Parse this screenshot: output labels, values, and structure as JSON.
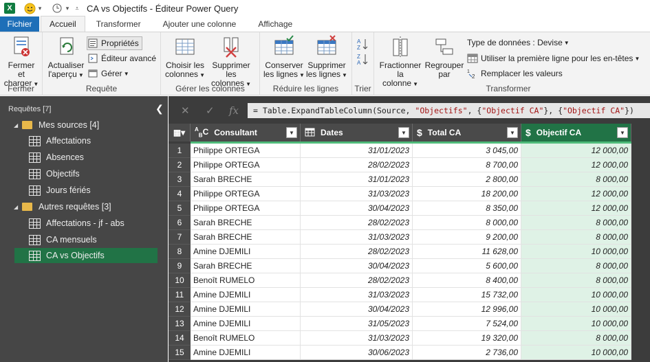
{
  "window": {
    "title": "CA vs Objectifs - Éditeur Power Query"
  },
  "tabs": [
    {
      "label": "Fichier"
    },
    {
      "label": "Accueil"
    },
    {
      "label": "Transformer"
    },
    {
      "label": "Ajouter une colonne"
    },
    {
      "label": "Affichage"
    }
  ],
  "ribbon": {
    "fermer": {
      "btn_line1": "Fermer et",
      "btn_line2": "charger",
      "group": "Fermer"
    },
    "requete": {
      "actualiser_line1": "Actualiser",
      "actualiser_line2": "l'aperçu",
      "proprietes": "Propriétés",
      "editeur": "Éditeur avancé",
      "gerer": "Gérer",
      "group": "Requête"
    },
    "colonnes": {
      "choisir_line1": "Choisir les",
      "choisir_line2": "colonnes",
      "supprimer_line1": "Supprimer les",
      "supprimer_line2": "colonnes",
      "group": "Gérer les colonnes"
    },
    "lignes": {
      "conserver_line1": "Conserver",
      "conserver_line2": "les lignes",
      "supprimer_line1": "Supprimer",
      "supprimer_line2": "les lignes",
      "group": "Réduire les lignes"
    },
    "trier": {
      "group": "Trier"
    },
    "transformer": {
      "fractionner_line1": "Fractionner",
      "fractionner_line2": "la colonne",
      "regrouper_line1": "Regrouper",
      "regrouper_line2": "par",
      "type_donnees": "Type de données : Devise",
      "premiere_ligne": "Utiliser la première ligne pour les en-têtes",
      "remplacer": "Remplacer les valeurs",
      "group": "Transformer"
    }
  },
  "queries_pane": {
    "header": "Requêtes [7]",
    "groups": [
      {
        "name": "Mes sources [4]",
        "items": [
          "Affectations",
          "Absences",
          "Objectifs",
          "Jours fériés"
        ]
      },
      {
        "name": "Autres requêtes [3]",
        "items": [
          "Affectations - jf - abs",
          "CA mensuels",
          "CA vs Objectifs"
        ]
      }
    ],
    "selected": "CA vs Objectifs"
  },
  "formula": {
    "prefix": "= Table.ExpandTableColumn(Source, ",
    "s1": "\"Objectifs\"",
    "mid1": ", {",
    "s2": "\"Objectif CA\"",
    "mid2": "}, {",
    "s3": "\"Objectif CA\"",
    "suffix": "})"
  },
  "grid": {
    "columns": [
      {
        "type_icon": "ABC",
        "name": "Consultant"
      },
      {
        "type_icon": "calendar",
        "name": "Dates"
      },
      {
        "type_icon": "$",
        "name": "Total CA"
      },
      {
        "type_icon": "$",
        "name": "Objectif CA"
      }
    ],
    "rows": [
      [
        "1",
        "Philippe ORTEGA",
        "31/01/2023",
        "3 045,00",
        "12 000,00"
      ],
      [
        "2",
        "Philippe ORTEGA",
        "28/02/2023",
        "8 700,00",
        "12 000,00"
      ],
      [
        "3",
        "Sarah BRECHE",
        "31/01/2023",
        "2 800,00",
        "8 000,00"
      ],
      [
        "4",
        "Philippe ORTEGA",
        "31/03/2023",
        "18 200,00",
        "12 000,00"
      ],
      [
        "5",
        "Philippe ORTEGA",
        "30/04/2023",
        "8 350,00",
        "12 000,00"
      ],
      [
        "6",
        "Sarah BRECHE",
        "28/02/2023",
        "8 000,00",
        "8 000,00"
      ],
      [
        "7",
        "Sarah BRECHE",
        "31/03/2023",
        "9 200,00",
        "8 000,00"
      ],
      [
        "8",
        "Amine DJEMILI",
        "28/02/2023",
        "11 628,00",
        "10 000,00"
      ],
      [
        "9",
        "Sarah BRECHE",
        "30/04/2023",
        "5 600,00",
        "8 000,00"
      ],
      [
        "10",
        "Benoît RUMELO",
        "28/02/2023",
        "8 400,00",
        "8 000,00"
      ],
      [
        "11",
        "Amine DJEMILI",
        "31/03/2023",
        "15 732,00",
        "10 000,00"
      ],
      [
        "12",
        "Amine DJEMILI",
        "30/04/2023",
        "12 996,00",
        "10 000,00"
      ],
      [
        "13",
        "Amine DJEMILI",
        "31/05/2023",
        "7 524,00",
        "10 000,00"
      ],
      [
        "14",
        "Benoît RUMELO",
        "31/03/2023",
        "19 320,00",
        "8 000,00"
      ],
      [
        "15",
        "Amine DJEMILI",
        "30/06/2023",
        "2 736,00",
        "10 000,00"
      ]
    ]
  },
  "colors": {
    "accent_green": "#217346",
    "file_tab": "#1e6fb8",
    "pane_bg": "#464646",
    "selected_column_bg": "#dff2e6"
  }
}
